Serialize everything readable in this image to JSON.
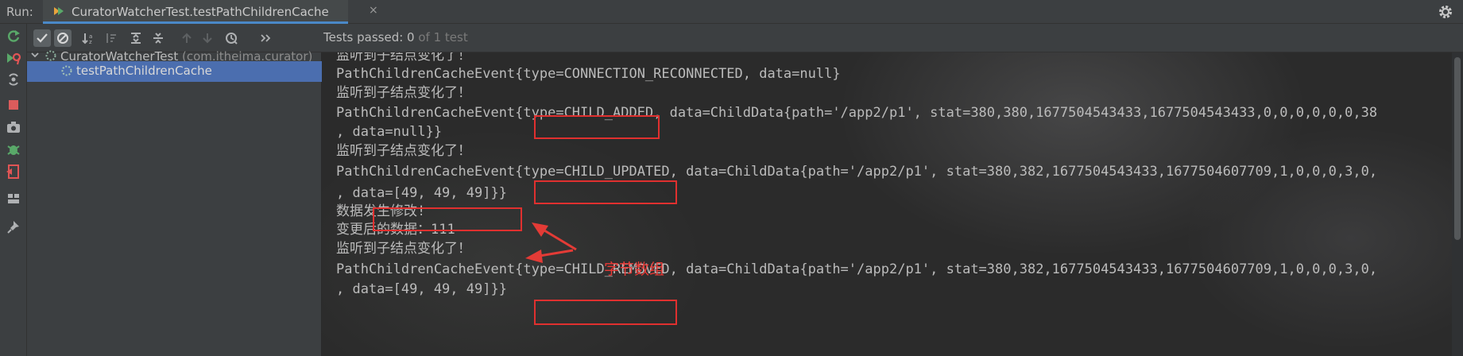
{
  "run_bar": {
    "label": "Run:",
    "tab_title": "CuratorWatcherTest.testPathChildrenCache",
    "tab_close": "×"
  },
  "test_toolbar": {
    "status_label": "Tests passed: ",
    "passed_count": "0",
    "total_text": " of 1 test"
  },
  "tree": {
    "root": {
      "name": "CuratorWatcherTest",
      "package": " (com.itheima.curator)"
    },
    "child": {
      "name": "testPathChildrenCache"
    }
  },
  "console": {
    "lines": [
      "监听到子结点变化了！",
      "PathChildrenCacheEvent{type=CONNECTION_RECONNECTED, data=null}",
      "监听到子结点变化了！",
      "PathChildrenCacheEvent{type=CHILD_ADDED, data=ChildData{path='/app2/p1', stat=380,380,1677504543433,1677504543433,0,0,0,0,0,0,38",
      ", data=null}}",
      "监听到子结点变化了！",
      "PathChildrenCacheEvent{type=CHILD_UPDATED, data=ChildData{path='/app2/p1', stat=380,382,1677504543433,1677504607709,1,0,0,0,3,0,",
      ", data=[49, 49, 49]}}",
      "数据发生修改!",
      "变更后的数据：111",
      "监听到子结点变化了！",
      "PathChildrenCacheEvent{type=CHILD_REMOVED, data=ChildData{path='/app2/p1', stat=380,382,1677504543433,1677504607709,1,0,0,0,3,0,",
      ", data=[49, 49, 49]}}"
    ],
    "annotation": "字节数组"
  },
  "colors": {
    "background": "#2b2b2b",
    "panel": "#3c3f41",
    "selection": "#4b6eaf",
    "highlight_box": "#e0302f",
    "annotation": "#ea3a36",
    "text": "#bbbbbb"
  },
  "icons": {
    "run_tab": "test-run-icon",
    "settings": "gear-icon",
    "left_toolbar": [
      "rerun-icon",
      "rerun-failed-icon",
      "toggle-auto-test-icon",
      "stop-icon",
      "screenshot-icon",
      "debug-icon",
      "exit-icon",
      "layout-icon",
      "pin-icon"
    ],
    "test_toolbar": [
      "show-passed-icon",
      "show-ignored-icon",
      "sort-alpha-icon",
      "sort-duration-icon",
      "expand-all-icon",
      "collapse-all-icon",
      "prev-failed-icon",
      "next-failed-icon",
      "history-icon",
      "more-icon"
    ]
  }
}
